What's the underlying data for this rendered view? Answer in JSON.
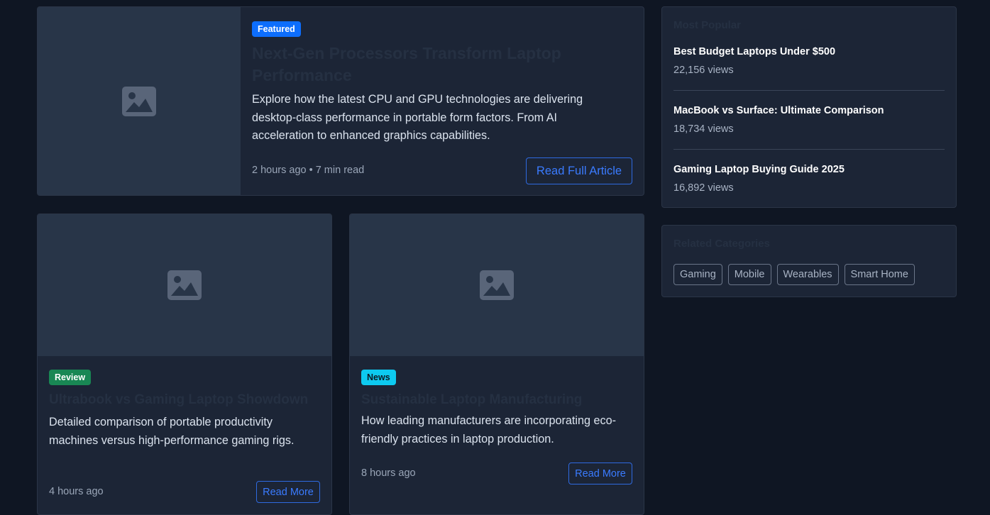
{
  "featured": {
    "badge": "Featured",
    "title": "Next-Gen Processors Transform Laptop Performance",
    "description": "Explore how the latest CPU and GPU technologies are delivering desktop-class performance in portable form factors. From AI acceleration to enhanced graphics capabilities.",
    "meta": "2 hours ago • 7 min read",
    "button_label": "Read Full Article",
    "image_icon": "image-placeholder-icon"
  },
  "cards": [
    {
      "badge": "Review",
      "title": "Ultrabook vs Gaming Laptop Showdown",
      "description": "Detailed comparison of portable productivity machines versus high-performance gaming rigs.",
      "meta": "4 hours ago",
      "button_label": "Read More"
    },
    {
      "badge": "News",
      "title": "Sustainable Laptop Manufacturing",
      "description": "How leading manufacturers are incorporating eco-friendly practices in laptop production.",
      "meta": "8 hours ago",
      "button_label": "Read More"
    }
  ],
  "sidebar": {
    "popular": {
      "heading": "Most Popular",
      "items": [
        {
          "title": "Best Budget Laptops Under $500",
          "views": "22,156 views"
        },
        {
          "title": "MacBook vs Surface: Ultimate Comparison",
          "views": "18,734 views"
        },
        {
          "title": "Gaming Laptop Buying Guide 2025",
          "views": "16,892 views"
        }
      ]
    },
    "categories": {
      "heading": "Related Categories",
      "tags": [
        "Gaming",
        "Mobile",
        "Wearables",
        "Smart Home"
      ]
    }
  },
  "colors": {
    "page_bg": "#0f1623",
    "card_bg": "#1c2536",
    "image_bg": "#283548",
    "badge_featured": "#0d6efd",
    "badge_review": "#198754",
    "badge_news": "#0dcaf0",
    "link": "#3a7bff"
  }
}
